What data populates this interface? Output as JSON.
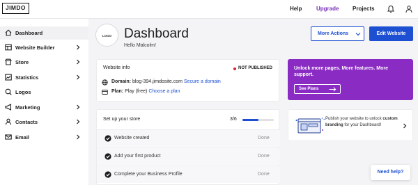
{
  "topbar": {
    "logo": "JIMDO",
    "nav": [
      {
        "label": "Help"
      },
      {
        "label": "Upgrade"
      },
      {
        "label": "Projects"
      }
    ],
    "icons": [
      "bell-icon",
      "user-icon"
    ]
  },
  "sidebar": {
    "items": [
      {
        "label": "Dashboard",
        "icon": "home-icon",
        "active": true,
        "chevron": false
      },
      {
        "label": "Website Builder",
        "icon": "website-builder-icon",
        "active": false,
        "chevron": true
      },
      {
        "label": "Store",
        "icon": "store-icon",
        "active": false,
        "chevron": true
      },
      {
        "label": "Statistics",
        "icon": "statistics-icon",
        "active": false,
        "chevron": true
      },
      {
        "label": "Logos",
        "icon": "logos-icon",
        "active": false,
        "chevron": false
      },
      {
        "label": "Marketing",
        "icon": "megaphone-icon",
        "active": false,
        "chevron": true
      },
      {
        "label": "Contacts",
        "icon": "contacts-icon",
        "active": false,
        "chevron": true
      },
      {
        "label": "Email",
        "icon": "email-icon",
        "active": false,
        "chevron": true
      }
    ]
  },
  "header": {
    "logo_placeholder": "LOGO",
    "title": "Dashboard",
    "subtitle": "Hello Malcolm!",
    "more_actions_label": "More Actions",
    "edit_website_label": "Edit Website"
  },
  "website_info": {
    "title": "Website info",
    "status": "NOT PUBLISHED",
    "domain_label": "Domain:",
    "domain_value": "blog-394.jimdosite.com",
    "domain_link": "Secure a domain",
    "plan_label": "Plan:",
    "plan_value": "Play (free)",
    "plan_link": "Choose a plan"
  },
  "store_setup": {
    "title": "Set up your store",
    "count": "3/6",
    "progress": 0.5,
    "tasks": [
      {
        "label": "Website created",
        "status": "Done"
      },
      {
        "label": "Add your first product",
        "status": "Done"
      },
      {
        "label": "Complete your Business Profile",
        "status": "Done"
      }
    ]
  },
  "promo": {
    "text": "Unlock more pages. More features. More support.",
    "button_label": "See Plans"
  },
  "publish": {
    "text_prefix": "Publish your website to unlock ",
    "text_bold": "custom branding",
    "text_suffix": " for your Dashboard!"
  },
  "help_button": "Need help?",
  "colors": {
    "primary": "#1c4fd1",
    "promo": "#8a2bc4",
    "upgrade": "#7a2fb8",
    "status_dot": "#d6262a"
  }
}
